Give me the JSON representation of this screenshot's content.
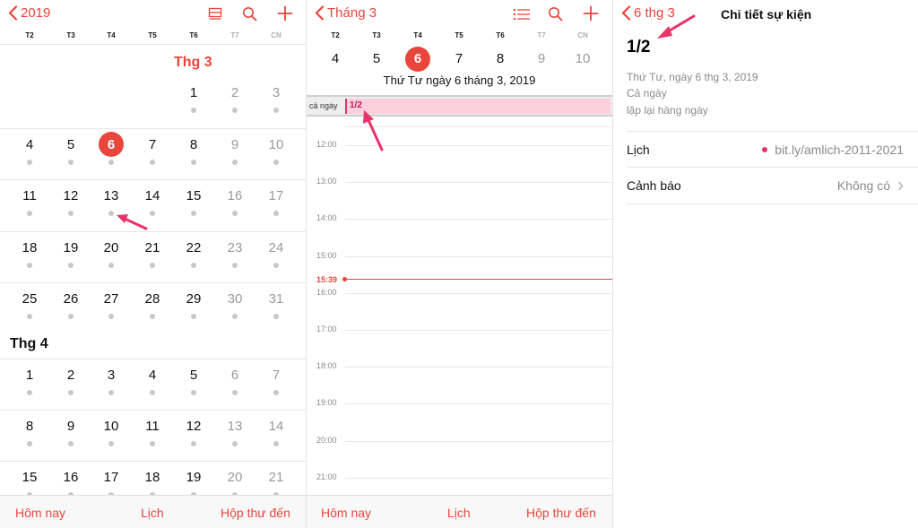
{
  "accent_color": "#e8453c",
  "panel1": {
    "back_label": "2019",
    "icons": [
      "inbox-tray-icon",
      "search-icon",
      "add-icon"
    ],
    "weekdays": [
      "T2",
      "T3",
      "T4",
      "T5",
      "T6",
      "T7",
      "CN"
    ],
    "march_label": "Thg 3",
    "april_label": "Thg 4",
    "weeks": [
      [
        "",
        "",
        "",
        "",
        "1",
        "2",
        "3"
      ],
      [
        "4",
        "5",
        "6",
        "7",
        "8",
        "9",
        "10"
      ],
      [
        "11",
        "12",
        "13",
        "14",
        "15",
        "16",
        "17"
      ],
      [
        "18",
        "19",
        "20",
        "21",
        "22",
        "23",
        "24"
      ],
      [
        "25",
        "26",
        "27",
        "28",
        "29",
        "30",
        "31"
      ],
      [
        "1",
        "2",
        "3",
        "4",
        "5",
        "6",
        "7"
      ],
      [
        "8",
        "9",
        "10",
        "11",
        "12",
        "13",
        "14"
      ],
      [
        "15",
        "16",
        "17",
        "18",
        "19",
        "20",
        "21"
      ]
    ],
    "today": "6",
    "tabs": [
      "Hôm nay",
      "Lịch",
      "Hộp thư đến"
    ]
  },
  "panel2": {
    "back_label": "Tháng 3",
    "icons": [
      "list-icon",
      "search-icon",
      "add-icon"
    ],
    "weekdays": [
      "T2",
      "T3",
      "T4",
      "T5",
      "T6",
      "T7",
      "CN"
    ],
    "days": [
      "4",
      "5",
      "6",
      "7",
      "8",
      "9",
      "10"
    ],
    "today": "6",
    "date_caption": "Thứ Tư  ngày 6 tháng 3, 2019",
    "allday_label": "cả ngày",
    "allday_event": "1/2",
    "hours": [
      "12:00",
      "13:00",
      "14:00",
      "15:00",
      "16:00",
      "17:00",
      "18:00",
      "19:00",
      "20:00",
      "21:00"
    ],
    "now_time": "15:39",
    "tabs": [
      "Hôm nay",
      "Lịch",
      "Hộp thư đến"
    ]
  },
  "panel3": {
    "back_label": "6 thg 3",
    "title": "Chi tiết sự kiện",
    "event_title": "1/2",
    "date_line": "Thứ Tư, ngày 6 thg 3, 2019",
    "allday_line": "Cả ngày",
    "repeat_line": "lặp lại hàng ngày",
    "calendar_label": "Lịch",
    "calendar_value": "bit.ly/amlich-2011-2021",
    "calendar_dot_color": "#e0336b",
    "alert_label": "Cảnh báo",
    "alert_value": "Không có"
  }
}
